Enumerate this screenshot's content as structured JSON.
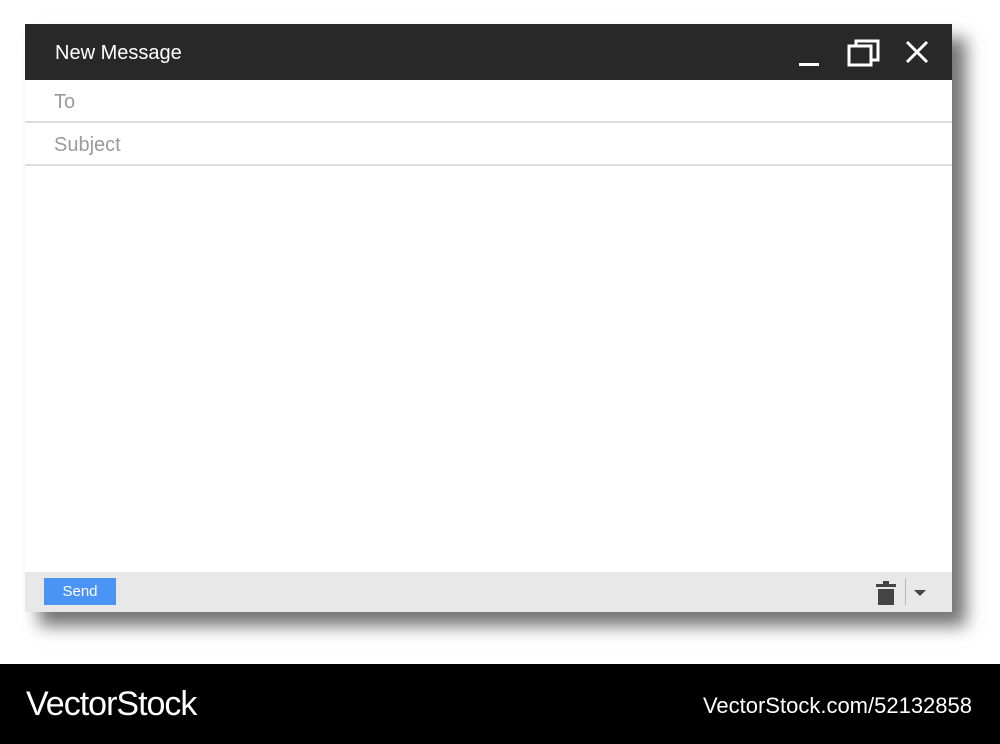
{
  "window": {
    "title": "New Message",
    "controls": {
      "minimize_icon": "minimize-icon",
      "maximize_icon": "maximize-icon",
      "close_icon": "close-icon"
    }
  },
  "fields": {
    "to": {
      "value": "",
      "placeholder": "To"
    },
    "subject": {
      "value": "",
      "placeholder": "Subject"
    },
    "body": {
      "value": ""
    }
  },
  "footer": {
    "send_label": "Send",
    "trash_icon": "trash-icon",
    "more_icon": "caret-down-icon"
  },
  "watermark": {
    "brand": "VectorStock",
    "url": "VectorStock.com/52132858"
  },
  "colors": {
    "title_bar": "#282828",
    "send_button": "#4a94f5",
    "footer_bar": "#e8e8e8",
    "watermark_bar": "#000000"
  }
}
